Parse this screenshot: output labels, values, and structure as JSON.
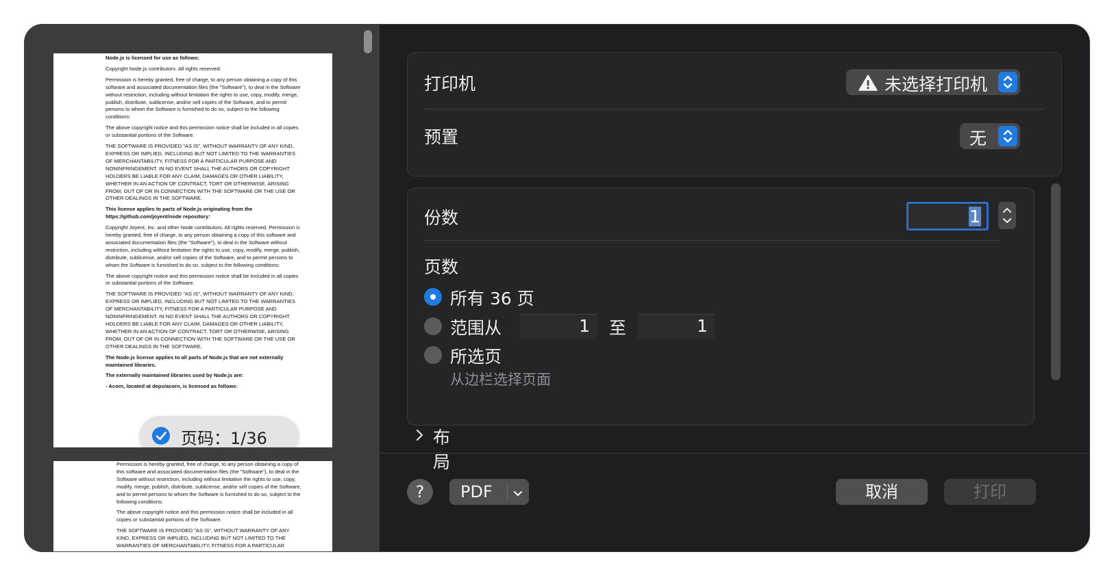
{
  "sidebar": {
    "page1_paragraphs": [
      {
        "bold": true,
        "text": "Node.js is licensed for use as follows:"
      },
      {
        "bold": false,
        "text": "Copyright Node.js contributors. All rights reserved."
      },
      {
        "bold": false,
        "text": "Permission is hereby granted, free of charge, to any person obtaining a copy of this software and associated documentation files (the \"Software\"), to deal in the Software without restriction, including without limitation the rights to use, copy, modify, merge, publish, distribute, sublicense, and/or sell copies of the Software, and to permit persons to whom the Software is furnished to do so, subject to the following conditions:"
      },
      {
        "bold": false,
        "text": "The above copyright notice and this permission notice shall be included in all copies or substantial portions of the Software."
      },
      {
        "bold": false,
        "text": "THE SOFTWARE IS PROVIDED \"AS IS\", WITHOUT WARRANTY OF ANY KIND, EXPRESS OR IMPLIED, INCLUDING BUT NOT LIMITED TO THE WARRANTIES OF MERCHANTABILITY, FITNESS FOR A PARTICULAR PURPOSE AND NONINFRINGEMENT. IN NO EVENT SHALL THE AUTHORS OR COPYRIGHT HOLDERS BE LIABLE FOR ANY CLAIM, DAMAGES OR OTHER LIABILITY, WHETHER IN AN ACTION OF CONTRACT, TORT OR OTHERWISE, ARISING FROM, OUT OF OR IN CONNECTION WITH THE SOFTWARE OR THE USE OR OTHER DEALINGS IN THE SOFTWARE."
      },
      {
        "bold": true,
        "text": "This license applies to parts of Node.js originating from the https://github.com/joyent/node repository:"
      },
      {
        "bold": false,
        "text": "Copyright Joyent, Inc. and other Node contributors. All rights reserved. Permission is hereby granted, free of charge, to any person obtaining a copy of this software and associated documentation files (the \"Software\"), to deal in the Software without restriction, including without limitation the rights to use, copy, modify, merge, publish, distribute, sublicense, and/or sell copies of the Software, and to permit persons to whom the Software is furnished to do so, subject to the following conditions:"
      },
      {
        "bold": false,
        "text": "The above copyright notice and this permission notice shall be included in all copies or substantial portions of the Software."
      },
      {
        "bold": false,
        "text": "THE SOFTWARE IS PROVIDED \"AS IS\", WITHOUT WARRANTY OF ANY KIND, EXPRESS OR IMPLIED, INCLUDING BUT NOT LIMITED TO THE WARRANTIES OF MERCHANTABILITY, FITNESS FOR A PARTICULAR PURPOSE AND NONINFRINGEMENT. IN NO EVENT SHALL THE AUTHORS OR COPYRIGHT HOLDERS BE LIABLE FOR ANY CLAIM, DAMAGES OR OTHER LIABILITY, WHETHER IN AN ACTION OF CONTRACT, TORT OR OTHERWISE, ARISING FROM, OUT OF OR IN CONNECTION WITH THE SOFTWARE OR THE USE OR OTHER DEALINGS IN THE SOFTWARE."
      },
      {
        "bold": true,
        "text": "The Node.js license applies to all parts of Node.js that are not externally maintained libraries."
      },
      {
        "bold": true,
        "text": "The externally maintained libraries used by Node.js are:"
      },
      {
        "bold": true,
        "text": "-   Acorn, located at deps/acorn, is licensed as follows:"
      }
    ],
    "page2_paragraphs": [
      {
        "bold": false,
        "text": "Permission is hereby granted, free of charge, to any person obtaining a copy of this software and associated documentation files (the \"Software\"), to deal in the Software without restriction, including without limitation the rights to use, copy, modify, merge, publish, distribute, sublicense, and/or sell copies of the Software, and to permit persons to whom the Software is furnished to do so, subject to the following conditions:"
      },
      {
        "bold": false,
        "text": "The above copyright notice and this permission notice shall be included in all copies or substantial portions of the Software."
      },
      {
        "bold": false,
        "text": "THE SOFTWARE IS PROVIDED \"AS IS\", WITHOUT WARRANTY OF ANY KIND, EXPRESS OR IMPLIED, INCLUDING BUT NOT LIMITED TO THE WARRANTIES OF MERCHANTABILITY, FITNESS FOR A PARTICULAR PURPOSE AND"
      }
    ],
    "page_badge": "页码：1/36"
  },
  "printer": {
    "label": "打印机",
    "value": "未选择打印机",
    "icon": "warning-icon"
  },
  "preset": {
    "label": "预置",
    "value": "无"
  },
  "copies": {
    "label": "份数",
    "value": "1"
  },
  "pages": {
    "label": "页数",
    "all_label": "所有 36 页",
    "range_label": "范围从",
    "range_from": "1",
    "range_to_label": "至",
    "range_to": "1",
    "selected_label": "所选页",
    "selected_hint": "从边栏选择页面",
    "selected_option": "all"
  },
  "layout_section": {
    "label": "布局"
  },
  "footer": {
    "help_label": "?",
    "pdf_label": "PDF",
    "cancel_label": "取消",
    "print_label": "打印"
  },
  "colors": {
    "accent": "#1f7be0",
    "dialog_bg": "#1e1e20",
    "sidebar_bg": "#3c3c3e"
  }
}
